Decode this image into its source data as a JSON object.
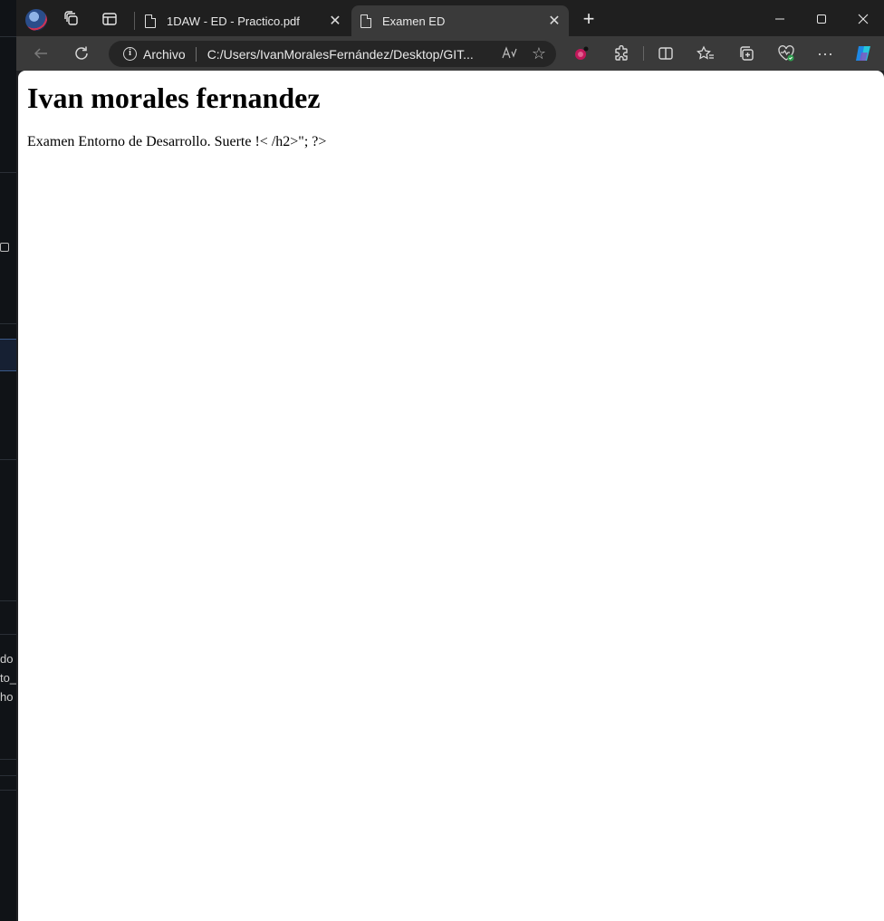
{
  "background_editor": {
    "fragments": [
      "do",
      "to_",
      "ho"
    ]
  },
  "browser": {
    "profile_icon": "profile-avatar",
    "tabs": [
      {
        "title": "1DAW - ED - Practico.pdf",
        "icon": "document-icon",
        "active": false
      },
      {
        "title": "Examen ED",
        "icon": "document-icon",
        "active": true
      }
    ],
    "new_tab_glyph": "+",
    "window_controls": {
      "minimize": "—",
      "maximize": "☐",
      "close": "✕"
    },
    "toolbar": {
      "site_info_label": "Archivo",
      "url": "C:/Users/IvanMoralesFernández/Desktop/GIT...",
      "read_aloud_glyph": "A̧ᵃ",
      "favorite_glyph": "☆"
    }
  },
  "page": {
    "heading": "Ivan morales fernandez",
    "paragraph": "Examen Entorno de Desarrollo. Suerte !< /h2>\"; ?>"
  },
  "colors": {
    "tabstrip": "#1f1f1f",
    "toolbar": "#3a3a3a",
    "addressbar": "#252525",
    "page_background": "#ffffff"
  }
}
